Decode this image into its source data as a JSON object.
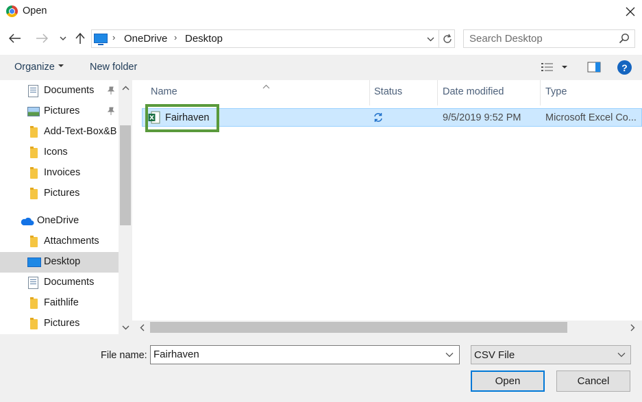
{
  "window": {
    "title": "Open",
    "app_icon": "chrome-icon"
  },
  "nav": {
    "back_icon": "back-arrow-icon",
    "forward_icon": "forward-arrow-icon",
    "recent_icon": "chevron-down-icon",
    "up_icon": "up-arrow-icon"
  },
  "address": {
    "crumbs": [
      "OneDrive",
      "Desktop"
    ]
  },
  "search": {
    "placeholder": "Search Desktop"
  },
  "toolbar": {
    "organize": "Organize",
    "new_folder": "New folder",
    "help": "?"
  },
  "sidebar": {
    "items": [
      {
        "label": "Documents",
        "icon": "document-icon",
        "pinned": true
      },
      {
        "label": "Pictures",
        "icon": "pictures-icon",
        "pinned": true
      },
      {
        "label": "Add-Text-Box&B",
        "icon": "folder-icon"
      },
      {
        "label": "Icons",
        "icon": "folder-icon"
      },
      {
        "label": "Invoices",
        "icon": "folder-icon"
      },
      {
        "label": "Pictures",
        "icon": "folder-icon"
      },
      {
        "label": "OneDrive",
        "icon": "onedrive-icon"
      },
      {
        "label": "Attachments",
        "icon": "folder-icon"
      },
      {
        "label": "Desktop",
        "icon": "desktop-icon",
        "selected": true
      },
      {
        "label": "Documents",
        "icon": "document-icon"
      },
      {
        "label": "Faithlife",
        "icon": "folder-icon"
      },
      {
        "label": "Pictures",
        "icon": "folder-icon"
      }
    ]
  },
  "filelist": {
    "columns": [
      "Name",
      "Status",
      "Date modified",
      "Type"
    ],
    "rows": [
      {
        "name": "Fairhaven",
        "status": "sync-icon",
        "date": "9/5/2019 9:52 PM",
        "type": "Microsoft Excel Co..."
      }
    ]
  },
  "bottom": {
    "file_name_label": "File name:",
    "file_name_value": "Fairhaven",
    "file_type": "CSV File",
    "open_label": "Open",
    "cancel_label": "Cancel"
  },
  "colors": {
    "selection": "#cce8ff",
    "highlight_box": "#5a9a3c",
    "accent": "#0078d7"
  }
}
